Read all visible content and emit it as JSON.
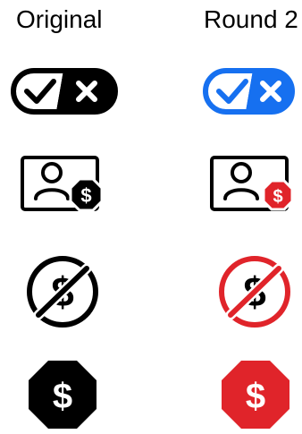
{
  "columns": {
    "original_heading": "Original",
    "round2_heading": "Round 2"
  },
  "colors": {
    "original": "#000000",
    "toggle_accent": "#1670f0",
    "alert_red": "#e0242a",
    "background": "#ffffff"
  },
  "icons": [
    {
      "name": "toggle-check-x-icon"
    },
    {
      "name": "user-card-dollar-icon"
    },
    {
      "name": "no-dollar-icon"
    },
    {
      "name": "dollar-octagon-icon"
    }
  ],
  "glyphs": {
    "dollar": "$"
  }
}
